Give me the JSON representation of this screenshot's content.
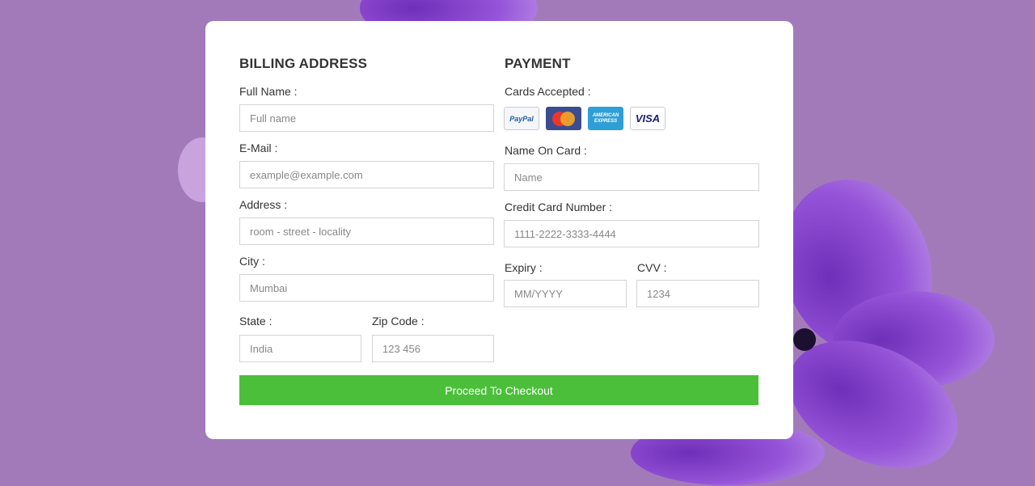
{
  "billing": {
    "heading": "BILLING ADDRESS",
    "full_name": {
      "label": "Full Name :",
      "placeholder": "Full name"
    },
    "email": {
      "label": "E-Mail :",
      "placeholder": "example@example.com"
    },
    "address": {
      "label": "Address :",
      "placeholder": "room - street - locality"
    },
    "city": {
      "label": "City :",
      "placeholder": "Mumbai"
    },
    "state": {
      "label": "State :",
      "placeholder": "India"
    },
    "zip": {
      "label": "Zip Code :",
      "placeholder": "123 456"
    }
  },
  "payment": {
    "heading": "PAYMENT",
    "cards_label": "Cards Accepted :",
    "cards": [
      {
        "name": "paypal",
        "text": "PayPal",
        "color": "#1f5ea8"
      },
      {
        "name": "mastercard",
        "text": "MasterCard",
        "color": "#e8372f"
      },
      {
        "name": "american-express",
        "text": "AMERICAN EXPRESS",
        "color": "#2e9fd6"
      },
      {
        "name": "visa",
        "text": "VISA",
        "color": "#1a1f71"
      }
    ],
    "name_on_card": {
      "label": "Name On Card :",
      "placeholder": "Name"
    },
    "card_number": {
      "label": "Credit Card Number :",
      "placeholder": "1111-2222-3333-4444"
    },
    "expiry": {
      "label": "Expiry :",
      "placeholder": "MM/YYYY"
    },
    "cvv": {
      "label": "CVV :",
      "placeholder": "1234"
    }
  },
  "checkout_button": "Proceed To Checkout",
  "colors": {
    "background": "#9b72b5",
    "flower": "#8a45cf",
    "button": "#4bbf3a"
  }
}
